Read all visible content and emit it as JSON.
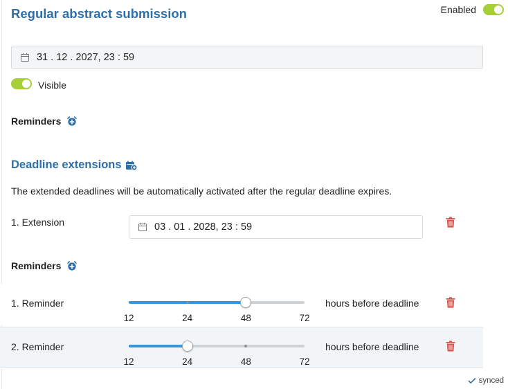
{
  "header": {
    "title": "Regular abstract submission",
    "enabled_label": "Enabled",
    "enabled": true
  },
  "deadline": {
    "value": "31 . 12 . 2027, 23 : 59",
    "visible_label": "Visible",
    "visible": true
  },
  "reminders": {
    "heading": "Reminders"
  },
  "extensions": {
    "heading": "Deadline extensions",
    "note": "The extended deadlines will be automatically activated after the regular deadline expires.",
    "items": [
      {
        "label": "1. Extension",
        "date": "03 . 01 . 2028, 23 : 59",
        "reminders_heading": "Reminders",
        "reminders": [
          {
            "label": "1. Reminder",
            "value": 48,
            "suffix": "hours before deadline"
          },
          {
            "label": "2. Reminder",
            "value": 24,
            "suffix": "hours before deadline"
          }
        ]
      }
    ]
  },
  "slider_ticks": [
    "12",
    "24",
    "48",
    "72"
  ],
  "status": {
    "synced_label": "synced"
  },
  "colors": {
    "accent": "#2f6ea6",
    "toggle_on": "#a6cf3a",
    "slider": "#3a94d8",
    "delete": "#d9534f"
  }
}
